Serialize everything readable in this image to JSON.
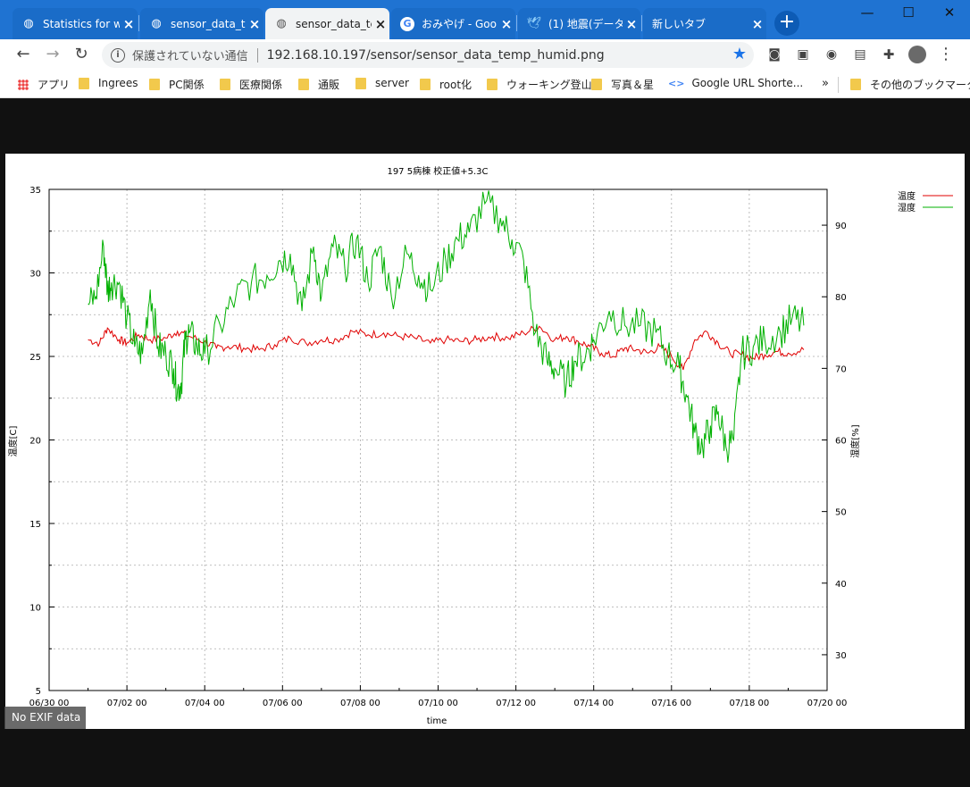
{
  "tabs": [
    {
      "title": "Statistics for w",
      "icon": "globe-icon",
      "active": false
    },
    {
      "title": "sensor_data_te",
      "icon": "globe-icon",
      "active": false
    },
    {
      "title": "sensor_data_te",
      "icon": "globe-icon",
      "active": true
    },
    {
      "title": "おみやげ - Goo",
      "icon": "google-icon",
      "active": false
    },
    {
      "title": "(1) 地震(データ",
      "icon": "twitter-icon",
      "active": false
    },
    {
      "title": "新しいタブ",
      "icon": "",
      "active": false
    }
  ],
  "window": {
    "minimize": "—",
    "maximize": "☐",
    "close": "✕"
  },
  "omnibox": {
    "security_text": "保護されていない通信",
    "url": "192.168.10.197/sensor/sensor_data_temp_humid.png"
  },
  "bookmarks": [
    {
      "label": "アプリ",
      "type": "apps"
    },
    {
      "label": "Ingrees",
      "type": "folder"
    },
    {
      "label": "PC関係",
      "type": "folder"
    },
    {
      "label": "医療関係",
      "type": "folder"
    },
    {
      "label": "通販",
      "type": "folder"
    },
    {
      "label": "server",
      "type": "folder"
    },
    {
      "label": "root化",
      "type": "folder"
    },
    {
      "label": "ウォーキング登山",
      "type": "folder"
    },
    {
      "label": "写真＆星",
      "type": "folder"
    },
    {
      "label": "Google URL Shorte...",
      "type": "link"
    }
  ],
  "bookmarks_overflow": "»",
  "other_bookmarks": "その他のブックマーク",
  "exif_label": "No EXIF data",
  "chart_data": {
    "type": "line",
    "title": "197 5病棟 校正値+5.3C",
    "xlabel": "time",
    "ylabel": "温度[C]",
    "y2label": "湿度[%]",
    "xticks": [
      "06/30 00",
      "07/02 00",
      "07/04 00",
      "07/06 00",
      "07/08 00",
      "07/10 00",
      "07/12 00",
      "07/14 00",
      "07/16 00",
      "07/18 00",
      "07/20 00"
    ],
    "yticks": [
      "35",
      "30",
      "25",
      "20",
      "15",
      "10",
      "5"
    ],
    "y2ticks": [
      "90",
      "80",
      "70",
      "60",
      "50",
      "40",
      "30"
    ],
    "xlim_days": [
      0,
      20
    ],
    "ylim": [
      5,
      35
    ],
    "y2lim": [
      25,
      95
    ],
    "grid": true,
    "legend_position": "top-right",
    "series": [
      {
        "name": "温度",
        "axis": "y",
        "color": "#e00000",
        "x_days": [
          1.0,
          1.3,
          1.5,
          1.8,
          2.0,
          2.3,
          2.6,
          3.0,
          3.3,
          3.6,
          4.0,
          4.3,
          4.6,
          5.0,
          5.4,
          5.8,
          6.2,
          6.6,
          7.0,
          7.4,
          7.8,
          8.2,
          8.6,
          9.0,
          9.4,
          9.8,
          10.2,
          10.6,
          11.0,
          11.4,
          11.8,
          12.2,
          12.6,
          13.0,
          13.3,
          13.6,
          13.9,
          14.2,
          14.5,
          14.8,
          15.1,
          15.4,
          15.7,
          16.0,
          16.3,
          16.6,
          16.9,
          17.2,
          17.5,
          17.8,
          18.1,
          18.4,
          18.7,
          19.0,
          19.4
        ],
        "values": [
          26.0,
          25.8,
          26.7,
          26.0,
          25.8,
          26.3,
          26.0,
          26.1,
          26.5,
          26.2,
          25.9,
          25.5,
          25.6,
          25.5,
          25.4,
          25.7,
          26.1,
          25.8,
          26.0,
          26.0,
          26.5,
          26.3,
          26.4,
          26.2,
          26.1,
          25.8,
          26.0,
          25.9,
          26.0,
          26.2,
          26.1,
          26.4,
          26.8,
          26.0,
          26.2,
          25.9,
          25.6,
          25.2,
          25.0,
          25.5,
          25.4,
          25.2,
          25.6,
          25.0,
          24.2,
          26.0,
          26.5,
          25.8,
          25.2,
          25.1,
          24.9,
          25.1,
          25.3,
          25.2,
          25.4
        ]
      },
      {
        "name": "湿度",
        "axis": "y2",
        "color": "#00b000",
        "x_days": [
          1.0,
          1.2,
          1.4,
          1.5,
          1.6,
          1.8,
          2.0,
          2.2,
          2.4,
          2.6,
          2.8,
          3.0,
          3.2,
          3.3,
          3.4,
          3.5,
          3.6,
          3.8,
          4.0,
          4.4,
          4.8,
          5.2,
          5.6,
          5.9,
          6.2,
          6.5,
          6.8,
          7.0,
          7.3,
          7.6,
          7.9,
          8.2,
          8.5,
          8.8,
          9.2,
          9.5,
          9.8,
          10.2,
          10.5,
          10.8,
          11.2,
          11.6,
          11.9,
          12.2,
          12.5,
          12.8,
          13.0,
          13.3,
          13.5,
          13.8,
          14.0,
          14.4,
          14.8,
          15.2,
          15.6,
          15.9,
          16.2,
          16.4,
          16.6,
          16.8,
          17.0,
          17.2,
          17.4,
          17.6,
          17.8,
          18.1,
          18.4,
          18.8,
          19.1,
          19.4
        ],
        "values": [
          79,
          80,
          87,
          81,
          82,
          82,
          77,
          73,
          72,
          81,
          73,
          72,
          70,
          67,
          68,
          74,
          75,
          73,
          72,
          76,
          80,
          82,
          83,
          85,
          86,
          78,
          87,
          80,
          87,
          84,
          88,
          82,
          87,
          80,
          86,
          83,
          81,
          85,
          88,
          89,
          93,
          91,
          88,
          85,
          75,
          71,
          70,
          68,
          71,
          72,
          74,
          78,
          76,
          76,
          75,
          72,
          70,
          66,
          61,
          59,
          62,
          64,
          59,
          60,
          72,
          73,
          74,
          75,
          77,
          76
        ]
      }
    ]
  }
}
